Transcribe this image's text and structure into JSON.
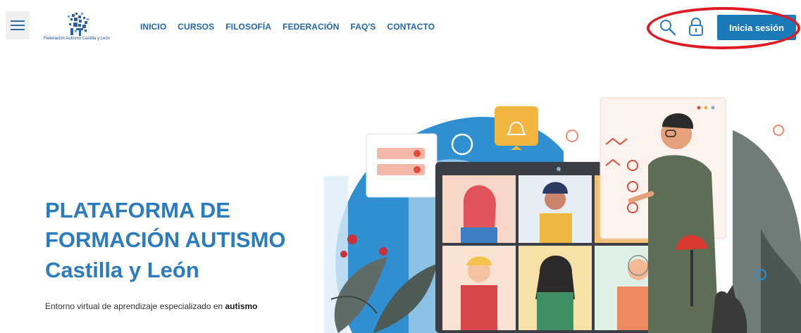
{
  "header": {
    "logo_caption": "Federación Autismo Castilla y León",
    "nav": [
      "INICIO",
      "CURSOS",
      "FILOSOFÍA",
      "FEDERACIÓN",
      "FAQ'S",
      "CONTACTO"
    ],
    "login_label": "Inicia sesión"
  },
  "hero": {
    "title": "PLATAFORMA DE FORMACIÓN AUTISMO",
    "subtitle": "Castilla y León",
    "description_prefix": "Entorno virtual de aprendizaje especializado en ",
    "description_bold": "autismo"
  },
  "colors": {
    "brand_blue": "#2b7bbf",
    "nav_blue": "#2268a6",
    "button_blue": "#1a7ab8",
    "highlight_red": "#e01a22"
  },
  "icons": [
    "menu-icon",
    "search-icon",
    "lock-icon",
    "bell-icon"
  ]
}
